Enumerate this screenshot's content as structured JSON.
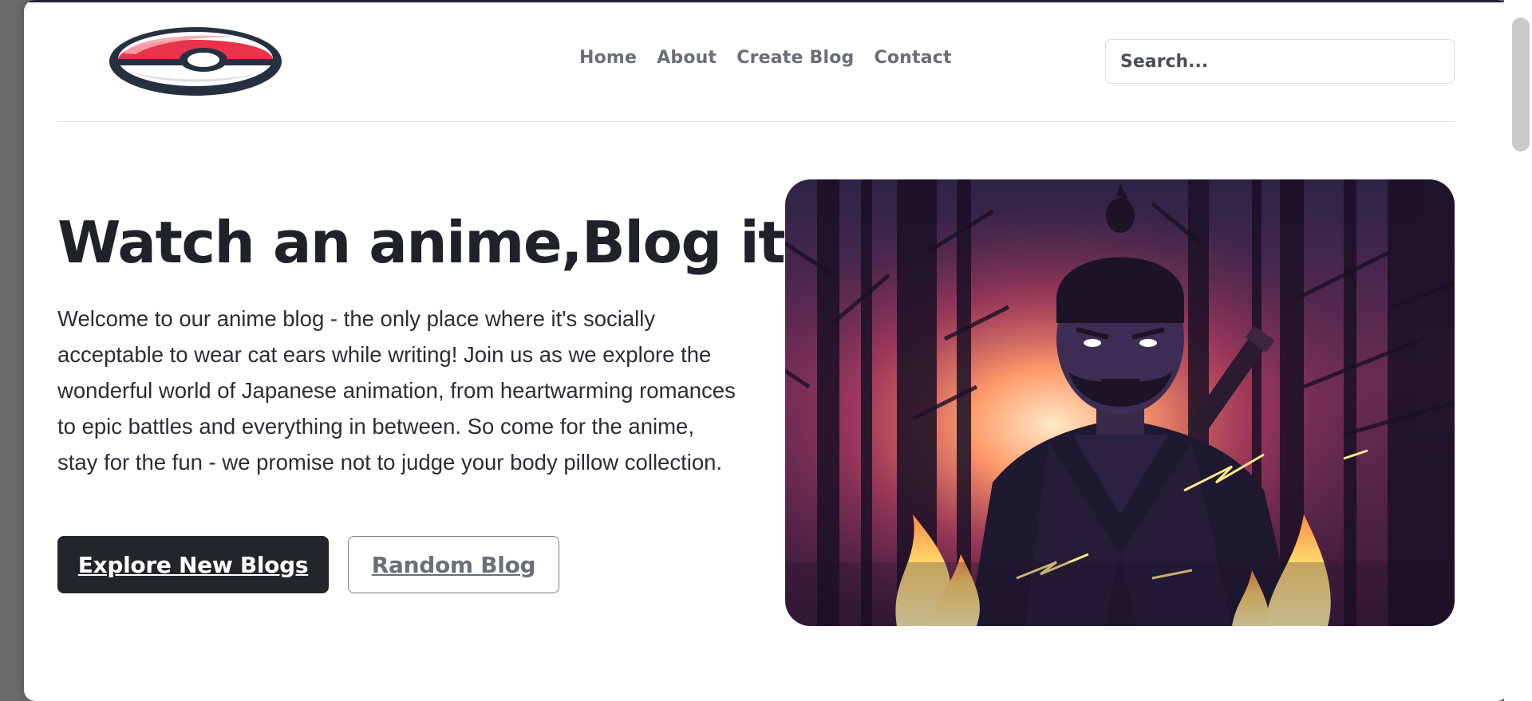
{
  "header": {
    "nav": [
      "Home",
      "About",
      "Create Blog",
      "Contact"
    ],
    "search_placeholder": "Search..."
  },
  "hero": {
    "title": "Watch an anime,Blog it",
    "text": "Welcome to our anime blog - the only place where it's socially acceptable to wear cat ears while writing! Join us as we explore the wonderful world of Japanese animation, from heartwarming romances to epic battles and everything in between. So come for the anime, stay for the fun - we promise not to judge your body pillow collection.",
    "primary_button": "Explore New Blogs",
    "secondary_button": "Random Blog"
  },
  "colors": {
    "dark": "#22262b",
    "nav_text": "#6a6f77",
    "logo_red": "#e8334a"
  },
  "icons": {
    "logo": "pokeball-logo"
  }
}
